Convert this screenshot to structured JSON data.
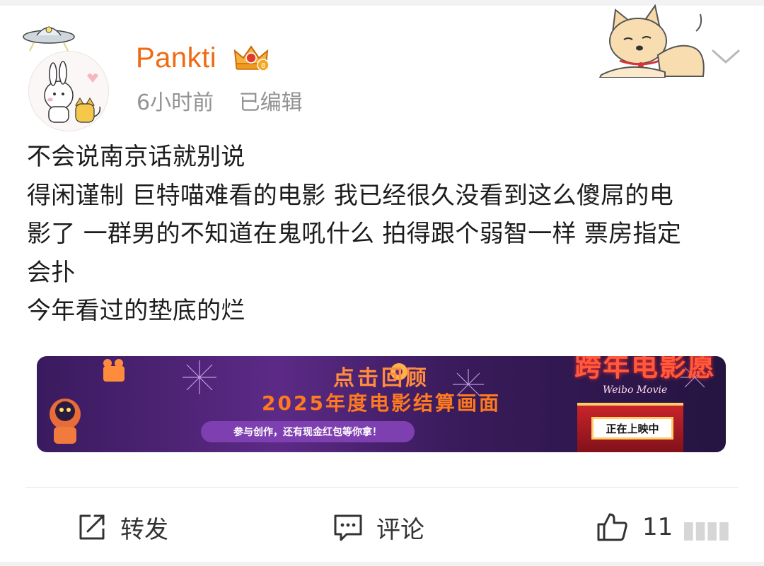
{
  "user": {
    "name": "Pankti",
    "time": "6小时前",
    "edited": "已编辑"
  },
  "post": {
    "lines": [
      "不会说南京话就别说",
      "得闲谨制 巨特喵难看的电影 我已经很久没看到这么傻屌的电",
      "影了 一群男的不知道在鬼吼什么 拍得跟个弱智一样 票房指定",
      "会扑",
      "今年看过的垫底的烂"
    ]
  },
  "banner": {
    "title": "点击回顾",
    "subtitle": "2025年度电影结算画面",
    "pill": "参与创作，还有现金红包等你拿！",
    "right_title": "跨年电影愿",
    "right_script": "Weibo Movie",
    "marquee": "正在上映中"
  },
  "actions": {
    "forward": "转发",
    "comment": "评论",
    "like_count": "11"
  },
  "colors": {
    "username": "#f06a12",
    "meta": "#939393",
    "text": "#1c1c1c"
  }
}
